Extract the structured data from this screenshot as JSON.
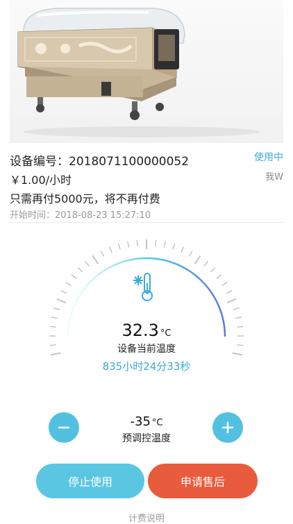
{
  "device": {
    "number_label": "设备编号：",
    "number": "2018071100000052",
    "status": "使用中",
    "price": "￥1.00/小时",
    "user": "我W",
    "notice": "只需再付5000元，将不再付费",
    "start_label": "开始时间：",
    "start_time": "2018-08-23 15:27:10"
  },
  "current": {
    "value": "32.3",
    "unit": "°C",
    "label": "设备当前温度",
    "elapsed": "835小时24分33秒"
  },
  "preset": {
    "value": "-35",
    "unit": "°C",
    "label": "预调控温度",
    "minus": "−",
    "plus": "+"
  },
  "actions": {
    "stop": "停止使用",
    "apply": "申请售后",
    "billing": "计费说明"
  },
  "colors": {
    "accent": "#3aaad8",
    "button_blue": "#5bc6e2",
    "button_red": "#e85b3c"
  },
  "icons": {
    "gauge": "snowflake-thermometer-icon",
    "minus": "minus-icon",
    "plus": "plus-icon"
  }
}
